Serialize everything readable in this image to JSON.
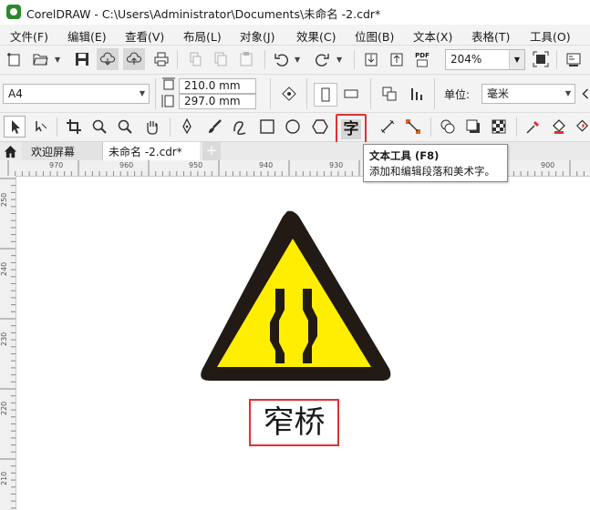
{
  "window": {
    "title": "CorelDRAW - C:\\Users\\Administrator\\Documents\\未命名 -2.cdr*"
  },
  "menu": {
    "items": [
      "文件(F)",
      "编辑(E)",
      "查看(V)",
      "布局(L)",
      "对象(J)",
      "效果(C)",
      "位图(B)",
      "文本(X)",
      "表格(T)",
      "工具(O)"
    ]
  },
  "standard_toolbar": {
    "zoom_value": "204%",
    "pdf_label": "PDF"
  },
  "property_bar": {
    "page_size": "A4",
    "width": "210.0 mm",
    "height": "297.0 mm",
    "units_label": "单位:",
    "units_value": "毫米"
  },
  "toolbox": {
    "highlighted_tool_glyph": "字",
    "highlighted_tool": "text-tool"
  },
  "tooltip": {
    "title": "文本工具 (F8)",
    "description": "添加和编辑段落和美术字。"
  },
  "tabs": {
    "items": [
      "欢迎屏幕",
      "未命名 -2.cdr*"
    ],
    "active_index": 1,
    "add_label": "+"
  },
  "ruler": {
    "horizontal": [
      "970",
      "960",
      "950",
      "940",
      "930",
      "900"
    ],
    "vertical": [
      "250",
      "240",
      "230",
      "220",
      "210"
    ]
  },
  "canvas": {
    "sign_text": "窄桥",
    "colors": {
      "sign_fill": "#ffee00",
      "sign_border": "#221a14",
      "highlight": "#e03030"
    }
  }
}
